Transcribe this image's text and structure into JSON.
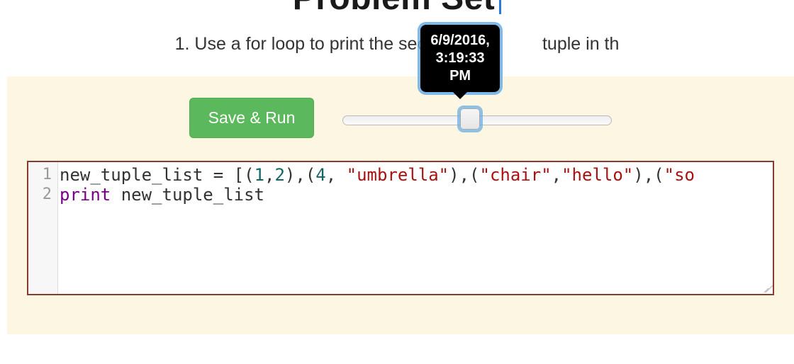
{
  "header_partial": "Problem Set",
  "problem": {
    "number": "1.",
    "text_before": "Use a for loop to print the second elem",
    "text_after": "tuple in th"
  },
  "controls": {
    "save_run_label": "Save & Run"
  },
  "slider": {
    "tooltip": "6/9/2016,\n3:19:33\nPM"
  },
  "code": {
    "gutters": [
      "1",
      "2"
    ],
    "line1": {
      "var": "new_tuple_list",
      "assign": " = ",
      "seg1": "[(",
      "n1": "1",
      "c1": ",",
      "n2": "2",
      "seg2": "),(",
      "n3": "4",
      "c2": ",  ",
      "s1": "\"umbrella\"",
      "seg3": "),(",
      "s2": "\"chair\"",
      "c3": ",",
      "s3": "\"hello\"",
      "seg4": "),(",
      "s4": "\"so"
    },
    "line2": {
      "kw": "print",
      "sp": " ",
      "var": "new_tuple_list"
    }
  }
}
